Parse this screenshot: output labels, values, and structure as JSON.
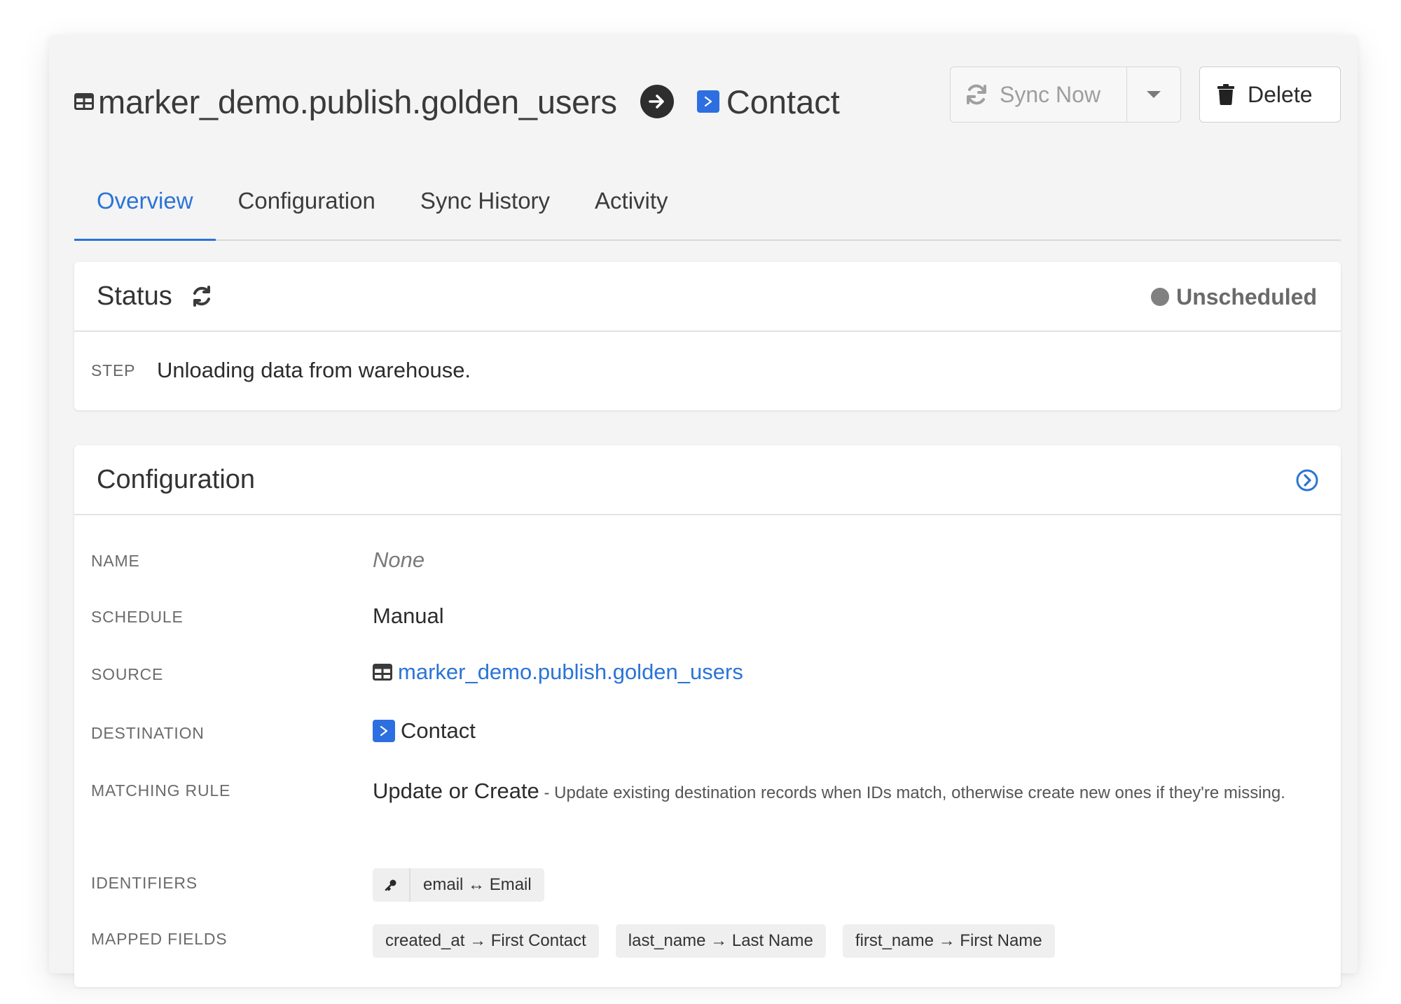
{
  "header": {
    "source_table": "marker_demo.publish.golden_users",
    "destination": "Contact",
    "sync_now_label": "Sync Now",
    "delete_label": "Delete"
  },
  "tabs": [
    {
      "label": "Overview",
      "active": true
    },
    {
      "label": "Configuration",
      "active": false
    },
    {
      "label": "Sync History",
      "active": false
    },
    {
      "label": "Activity",
      "active": false
    }
  ],
  "status_card": {
    "title": "Status",
    "state": "Unscheduled",
    "state_color": "#808080",
    "step_label": "STEP",
    "step_text": "Unloading data from warehouse."
  },
  "config_card": {
    "title": "Configuration",
    "rows": {
      "name": {
        "label": "NAME",
        "value": "None"
      },
      "schedule": {
        "label": "SCHEDULE",
        "value": "Manual"
      },
      "source": {
        "label": "SOURCE",
        "value": "marker_demo.publish.golden_users"
      },
      "destination": {
        "label": "DESTINATION",
        "value": "Contact"
      },
      "matching_rule": {
        "label": "MATCHING RULE",
        "name": "Update or Create",
        "description": " - Update existing destination records when IDs match, otherwise create new ones if they're missing."
      },
      "identifiers": {
        "label": "IDENTIFIERS",
        "value": "email ↔ Email"
      },
      "mapped_fields": {
        "label": "MAPPED FIELDS",
        "items": [
          "created_at → First Contact",
          "last_name → Last Name",
          "first_name → First Name"
        ]
      }
    }
  },
  "colors": {
    "accent": "#2a74d6",
    "destination_icon": "#2d6fe0"
  }
}
